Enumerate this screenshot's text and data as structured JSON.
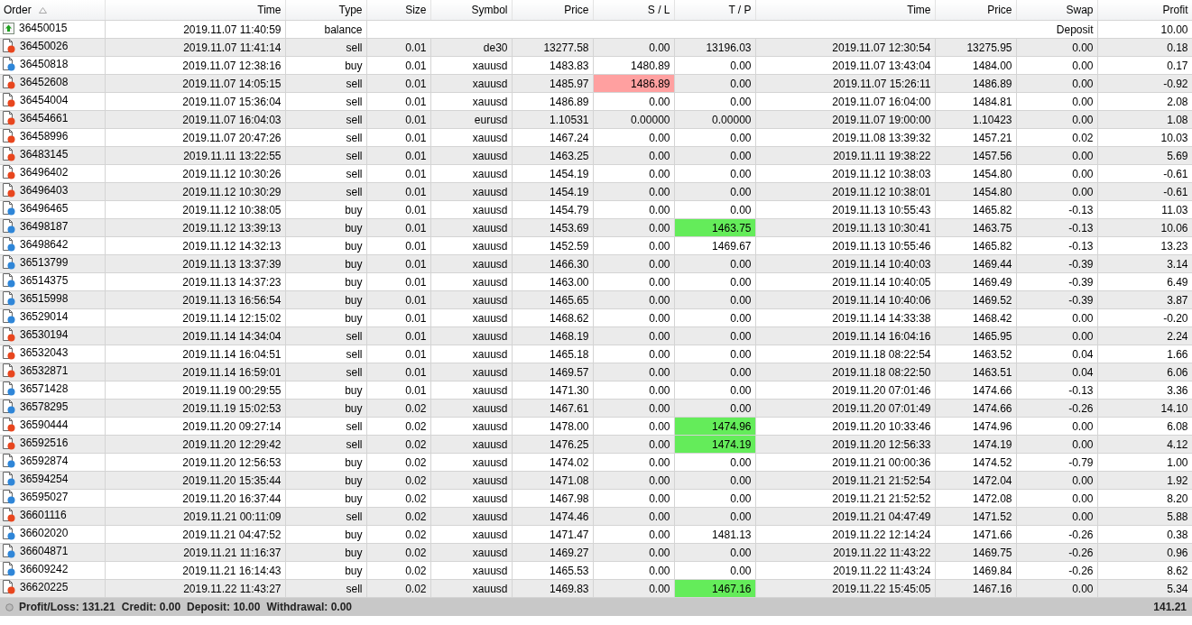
{
  "table": {
    "columns": [
      {
        "label": "Order",
        "sorted": true
      },
      {
        "label": "Time",
        "sorted": false
      },
      {
        "label": "Type",
        "sorted": false
      },
      {
        "label": "Size",
        "sorted": false
      },
      {
        "label": "Symbol",
        "sorted": false
      },
      {
        "label": "Price",
        "sorted": false
      },
      {
        "label": "S / L",
        "sorted": false
      },
      {
        "label": "T / P",
        "sorted": false
      },
      {
        "label": "Time",
        "sorted": false
      },
      {
        "label": "Price",
        "sorted": false
      },
      {
        "label": "Swap",
        "sorted": false
      },
      {
        "label": "Profit",
        "sorted": false
      }
    ],
    "rows": [
      {
        "kind": "balance",
        "order": "36450015",
        "time": "2019.11.07 11:40:59",
        "type": "balance",
        "comment": "Deposit",
        "profit": "10.00"
      },
      {
        "kind": "sell",
        "cells": [
          "36450026",
          "2019.11.07 11:41:14",
          "sell",
          "0.01",
          "de30",
          "13277.58",
          "0.00",
          "13196.03",
          "2019.11.07 12:30:54",
          "13275.95",
          "0.00",
          "0.18"
        ],
        "sl_hit": false,
        "tp_hit": false
      },
      {
        "kind": "buy",
        "cells": [
          "36450818",
          "2019.11.07 12:38:16",
          "buy",
          "0.01",
          "xauusd",
          "1483.83",
          "1480.89",
          "0.00",
          "2019.11.07 13:43:04",
          "1484.00",
          "0.00",
          "0.17"
        ],
        "sl_hit": false,
        "tp_hit": false
      },
      {
        "kind": "sell",
        "cells": [
          "36452608",
          "2019.11.07 14:05:15",
          "sell",
          "0.01",
          "xauusd",
          "1485.97",
          "1486.89",
          "0.00",
          "2019.11.07 15:26:11",
          "1486.89",
          "0.00",
          "-0.92"
        ],
        "sl_hit": true,
        "tp_hit": false
      },
      {
        "kind": "sell",
        "cells": [
          "36454004",
          "2019.11.07 15:36:04",
          "sell",
          "0.01",
          "xauusd",
          "1486.89",
          "0.00",
          "0.00",
          "2019.11.07 16:04:00",
          "1484.81",
          "0.00",
          "2.08"
        ],
        "sl_hit": false,
        "tp_hit": false
      },
      {
        "kind": "sell",
        "cells": [
          "36454661",
          "2019.11.07 16:04:03",
          "sell",
          "0.01",
          "eurusd",
          "1.10531",
          "0.00000",
          "0.00000",
          "2019.11.07 19:00:00",
          "1.10423",
          "0.00",
          "1.08"
        ],
        "sl_hit": false,
        "tp_hit": false
      },
      {
        "kind": "sell",
        "cells": [
          "36458996",
          "2019.11.07 20:47:26",
          "sell",
          "0.01",
          "xauusd",
          "1467.24",
          "0.00",
          "0.00",
          "2019.11.08 13:39:32",
          "1457.21",
          "0.02",
          "10.03"
        ],
        "sl_hit": false,
        "tp_hit": false
      },
      {
        "kind": "sell",
        "cells": [
          "36483145",
          "2019.11.11 13:22:55",
          "sell",
          "0.01",
          "xauusd",
          "1463.25",
          "0.00",
          "0.00",
          "2019.11.11 19:38:22",
          "1457.56",
          "0.00",
          "5.69"
        ],
        "sl_hit": false,
        "tp_hit": false
      },
      {
        "kind": "sell",
        "cells": [
          "36496402",
          "2019.11.12 10:30:26",
          "sell",
          "0.01",
          "xauusd",
          "1454.19",
          "0.00",
          "0.00",
          "2019.11.12 10:38:03",
          "1454.80",
          "0.00",
          "-0.61"
        ],
        "sl_hit": false,
        "tp_hit": false
      },
      {
        "kind": "sell",
        "cells": [
          "36496403",
          "2019.11.12 10:30:29",
          "sell",
          "0.01",
          "xauusd",
          "1454.19",
          "0.00",
          "0.00",
          "2019.11.12 10:38:01",
          "1454.80",
          "0.00",
          "-0.61"
        ],
        "sl_hit": false,
        "tp_hit": false
      },
      {
        "kind": "buy",
        "cells": [
          "36496465",
          "2019.11.12 10:38:05",
          "buy",
          "0.01",
          "xauusd",
          "1454.79",
          "0.00",
          "0.00",
          "2019.11.13 10:55:43",
          "1465.82",
          "-0.13",
          "11.03"
        ],
        "sl_hit": false,
        "tp_hit": false
      },
      {
        "kind": "buy",
        "cells": [
          "36498187",
          "2019.11.12 13:39:13",
          "buy",
          "0.01",
          "xauusd",
          "1453.69",
          "0.00",
          "1463.75",
          "2019.11.13 10:30:41",
          "1463.75",
          "-0.13",
          "10.06"
        ],
        "sl_hit": false,
        "tp_hit": true
      },
      {
        "kind": "buy",
        "cells": [
          "36498642",
          "2019.11.12 14:32:13",
          "buy",
          "0.01",
          "xauusd",
          "1452.59",
          "0.00",
          "1469.67",
          "2019.11.13 10:55:46",
          "1465.82",
          "-0.13",
          "13.23"
        ],
        "sl_hit": false,
        "tp_hit": false
      },
      {
        "kind": "buy",
        "cells": [
          "36513799",
          "2019.11.13 13:37:39",
          "buy",
          "0.01",
          "xauusd",
          "1466.30",
          "0.00",
          "0.00",
          "2019.11.14 10:40:03",
          "1469.44",
          "-0.39",
          "3.14"
        ],
        "sl_hit": false,
        "tp_hit": false
      },
      {
        "kind": "buy",
        "cells": [
          "36514375",
          "2019.11.13 14:37:23",
          "buy",
          "0.01",
          "xauusd",
          "1463.00",
          "0.00",
          "0.00",
          "2019.11.14 10:40:05",
          "1469.49",
          "-0.39",
          "6.49"
        ],
        "sl_hit": false,
        "tp_hit": false
      },
      {
        "kind": "buy",
        "cells": [
          "36515998",
          "2019.11.13 16:56:54",
          "buy",
          "0.01",
          "xauusd",
          "1465.65",
          "0.00",
          "0.00",
          "2019.11.14 10:40:06",
          "1469.52",
          "-0.39",
          "3.87"
        ],
        "sl_hit": false,
        "tp_hit": false
      },
      {
        "kind": "buy",
        "cells": [
          "36529014",
          "2019.11.14 12:15:02",
          "buy",
          "0.01",
          "xauusd",
          "1468.62",
          "0.00",
          "0.00",
          "2019.11.14 14:33:38",
          "1468.42",
          "0.00",
          "-0.20"
        ],
        "sl_hit": false,
        "tp_hit": false
      },
      {
        "kind": "sell",
        "cells": [
          "36530194",
          "2019.11.14 14:34:04",
          "sell",
          "0.01",
          "xauusd",
          "1468.19",
          "0.00",
          "0.00",
          "2019.11.14 16:04:16",
          "1465.95",
          "0.00",
          "2.24"
        ],
        "sl_hit": false,
        "tp_hit": false
      },
      {
        "kind": "sell",
        "cells": [
          "36532043",
          "2019.11.14 16:04:51",
          "sell",
          "0.01",
          "xauusd",
          "1465.18",
          "0.00",
          "0.00",
          "2019.11.18 08:22:54",
          "1463.52",
          "0.04",
          "1.66"
        ],
        "sl_hit": false,
        "tp_hit": false
      },
      {
        "kind": "sell",
        "cells": [
          "36532871",
          "2019.11.14 16:59:01",
          "sell",
          "0.01",
          "xauusd",
          "1469.57",
          "0.00",
          "0.00",
          "2019.11.18 08:22:50",
          "1463.51",
          "0.04",
          "6.06"
        ],
        "sl_hit": false,
        "tp_hit": false
      },
      {
        "kind": "buy",
        "cells": [
          "36571428",
          "2019.11.19 00:29:55",
          "buy",
          "0.01",
          "xauusd",
          "1471.30",
          "0.00",
          "0.00",
          "2019.11.20 07:01:46",
          "1474.66",
          "-0.13",
          "3.36"
        ],
        "sl_hit": false,
        "tp_hit": false
      },
      {
        "kind": "buy",
        "cells": [
          "36578295",
          "2019.11.19 15:02:53",
          "buy",
          "0.02",
          "xauusd",
          "1467.61",
          "0.00",
          "0.00",
          "2019.11.20 07:01:49",
          "1474.66",
          "-0.26",
          "14.10"
        ],
        "sl_hit": false,
        "tp_hit": false
      },
      {
        "kind": "sell",
        "cells": [
          "36590444",
          "2019.11.20 09:27:14",
          "sell",
          "0.02",
          "xauusd",
          "1478.00",
          "0.00",
          "1474.96",
          "2019.11.20 10:33:46",
          "1474.96",
          "0.00",
          "6.08"
        ],
        "sl_hit": false,
        "tp_hit": true
      },
      {
        "kind": "sell",
        "cells": [
          "36592516",
          "2019.11.20 12:29:42",
          "sell",
          "0.02",
          "xauusd",
          "1476.25",
          "0.00",
          "1474.19",
          "2019.11.20 12:56:33",
          "1474.19",
          "0.00",
          "4.12"
        ],
        "sl_hit": false,
        "tp_hit": true
      },
      {
        "kind": "buy",
        "cells": [
          "36592874",
          "2019.11.20 12:56:53",
          "buy",
          "0.02",
          "xauusd",
          "1474.02",
          "0.00",
          "0.00",
          "2019.11.21 00:00:36",
          "1474.52",
          "-0.79",
          "1.00"
        ],
        "sl_hit": false,
        "tp_hit": false
      },
      {
        "kind": "buy",
        "cells": [
          "36594254",
          "2019.11.20 15:35:44",
          "buy",
          "0.02",
          "xauusd",
          "1471.08",
          "0.00",
          "0.00",
          "2019.11.21 21:52:54",
          "1472.04",
          "0.00",
          "1.92"
        ],
        "sl_hit": false,
        "tp_hit": false
      },
      {
        "kind": "buy",
        "cells": [
          "36595027",
          "2019.11.20 16:37:44",
          "buy",
          "0.02",
          "xauusd",
          "1467.98",
          "0.00",
          "0.00",
          "2019.11.21 21:52:52",
          "1472.08",
          "0.00",
          "8.20"
        ],
        "sl_hit": false,
        "tp_hit": false
      },
      {
        "kind": "sell",
        "cells": [
          "36601116",
          "2019.11.21 00:11:09",
          "sell",
          "0.02",
          "xauusd",
          "1474.46",
          "0.00",
          "0.00",
          "2019.11.21 04:47:49",
          "1471.52",
          "0.00",
          "5.88"
        ],
        "sl_hit": false,
        "tp_hit": false
      },
      {
        "kind": "buy",
        "cells": [
          "36602020",
          "2019.11.21 04:47:52",
          "buy",
          "0.02",
          "xauusd",
          "1471.47",
          "0.00",
          "1481.13",
          "2019.11.22 12:14:24",
          "1471.66",
          "-0.26",
          "0.38"
        ],
        "sl_hit": false,
        "tp_hit": false
      },
      {
        "kind": "buy",
        "cells": [
          "36604871",
          "2019.11.21 11:16:37",
          "buy",
          "0.02",
          "xauusd",
          "1469.27",
          "0.00",
          "0.00",
          "2019.11.22 11:43:22",
          "1469.75",
          "-0.26",
          "0.96"
        ],
        "sl_hit": false,
        "tp_hit": false
      },
      {
        "kind": "buy",
        "cells": [
          "36609242",
          "2019.11.21 16:14:43",
          "buy",
          "0.02",
          "xauusd",
          "1465.53",
          "0.00",
          "0.00",
          "2019.11.22 11:43:24",
          "1469.84",
          "-0.26",
          "8.62"
        ],
        "sl_hit": false,
        "tp_hit": false
      },
      {
        "kind": "sell",
        "cells": [
          "36620225",
          "2019.11.22 11:43:27",
          "sell",
          "0.02",
          "xauusd",
          "1469.83",
          "0.00",
          "1467.16",
          "2019.11.22 15:45:05",
          "1467.16",
          "0.00",
          "5.34"
        ],
        "sl_hit": false,
        "tp_hit": true
      }
    ]
  },
  "summary": {
    "items": [
      "Profit/Loss: 131.21",
      "Credit: 0.00",
      "Deposit: 10.00",
      "Withdrawal: 0.00"
    ],
    "total": "141.21"
  }
}
